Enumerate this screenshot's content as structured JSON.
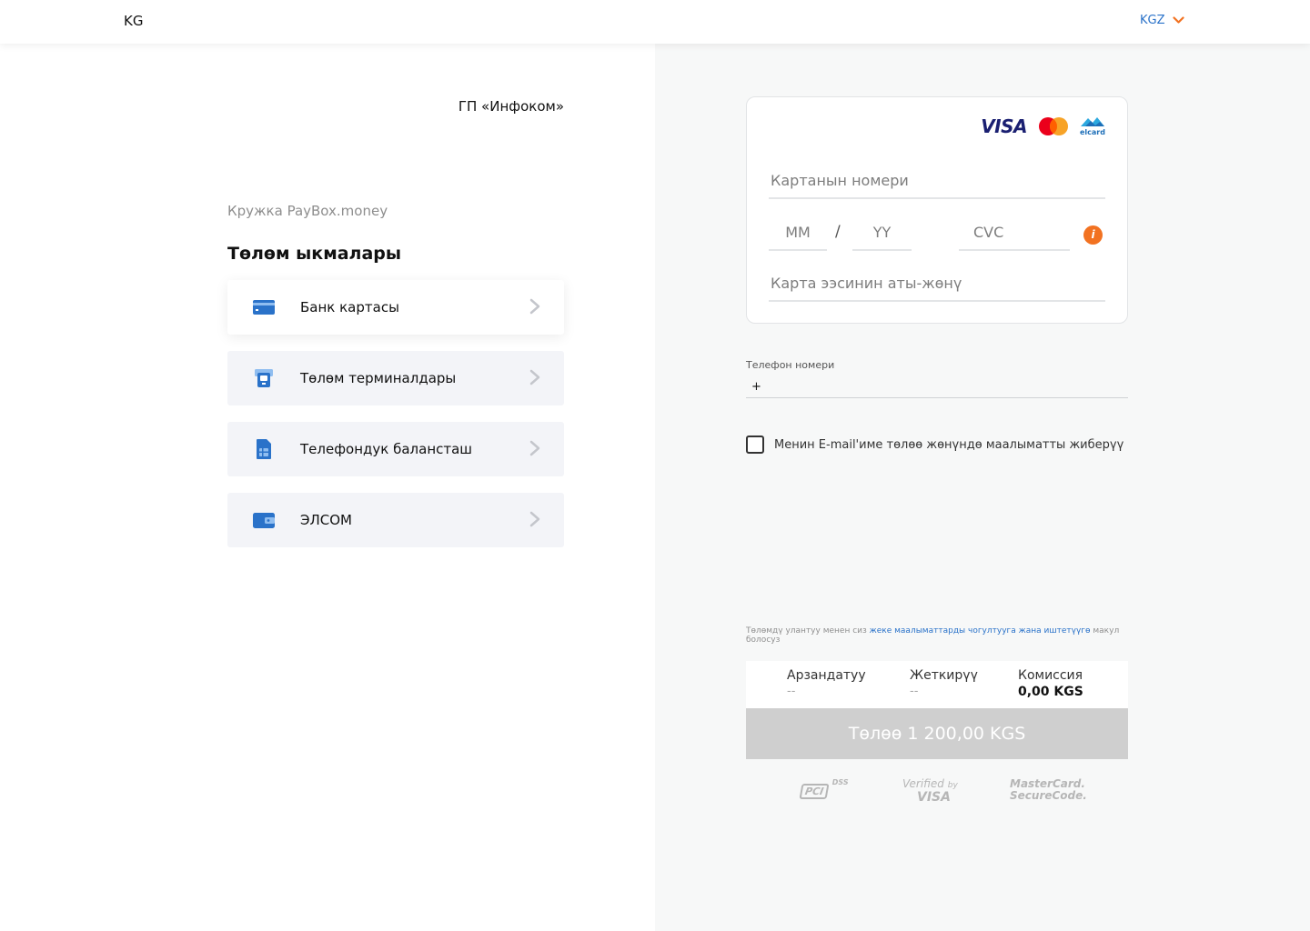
{
  "header": {
    "logo": "KG",
    "language": "KGZ"
  },
  "merchant": {
    "name": "ГП «Инфоком»",
    "order_title": "Кружка PayBox.money"
  },
  "methods": {
    "title": "Төлөм ыкмалары",
    "items": [
      {
        "label": "Банк картасы",
        "icon": "bank-card-icon"
      },
      {
        "label": "Төлөм терминалдары",
        "icon": "payment-terminal-icon"
      },
      {
        "label": "Телефондук балансташ",
        "icon": "sim-card-icon"
      },
      {
        "label": "ЭЛСОМ",
        "icon": "wallet-icon"
      }
    ]
  },
  "card_form": {
    "brands": {
      "visa": "VISA",
      "mastercard": "mastercard-logo",
      "elcard": "elcard"
    },
    "card_number_placeholder": "Картанын номери",
    "month_placeholder": "MM",
    "date_separator": "/",
    "year_placeholder": "YY",
    "cvc_placeholder": "CVC",
    "holder_placeholder": "Карта ээсинин аты-жөнү",
    "info_icon_glyph": "i"
  },
  "phone": {
    "label": "Телефон номери",
    "value": "+"
  },
  "email_checkbox": {
    "label": "Менин E-mail'име төлөө жөнүндө маалыматты жиберүү",
    "checked": false
  },
  "consent": {
    "before": "Төлөмдү улантуу менен сиз ",
    "link": "жеке маалыматтарды чогултууга жана иштетүүгө",
    "after": " макул болосуз"
  },
  "summary": {
    "discount_label": "Арзандатуу",
    "discount_value": "--",
    "delivery_label": "Жеткирүү",
    "delivery_value": "--",
    "commission_label": "Комиссия",
    "commission_value": "0,00 KGS"
  },
  "pay_button": "Төлөө 1 200,00 KGS",
  "trust_badges": {
    "pci": "PCI",
    "pci_dss": "DSS",
    "verified_top": "Verified",
    "verified_by": "by",
    "verified_brand": "VISA",
    "mc_line1": "MasterCard.",
    "mc_line2": "SecureCode."
  },
  "colors": {
    "accent_blue": "#2a72c9",
    "orange": "#f27221",
    "method_bg": "#f3f4f8",
    "right_bg": "#f7f8f8",
    "disabled_button": "#cfcfcf"
  }
}
